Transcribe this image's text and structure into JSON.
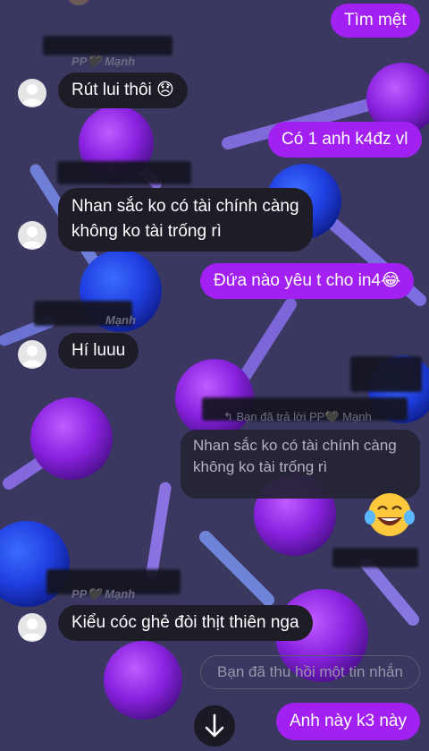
{
  "colors": {
    "background": "#3a3860",
    "outgoing_bubble": "#a320f2",
    "incoming_bubble": "#1e1d27"
  },
  "messages": {
    "m1": "Tìm mệt",
    "m2": "Rút lui thôi 😞",
    "m3": "Có 1 anh k4đz vl",
    "m4_line1": "Nhan sắc ko có tài chính càng",
    "m4_line2": "không ko tài trống rì",
    "m5": "Đứa nào yêu t cho in4😂",
    "m6": "Hí luuu",
    "m7": "Kiểu cóc ghẻ đòi thịt thiên nga",
    "m8": "Anh này k3 này"
  },
  "senders": {
    "s1": "PP🖤 Mạnh",
    "s3": "Mạnh",
    "s4": "PP🖤 Mạnh"
  },
  "reply": {
    "header": "↰ Bạn đã trả lời PP🖤 Mạnh",
    "quote_line1": "Nhan sắc ko có tài chính càng",
    "quote_line2": "không ko tài trống rì",
    "reaction_emoji": "😂"
  },
  "status": {
    "unsent": "Bạn đã thu hồi một tin nhắn"
  }
}
